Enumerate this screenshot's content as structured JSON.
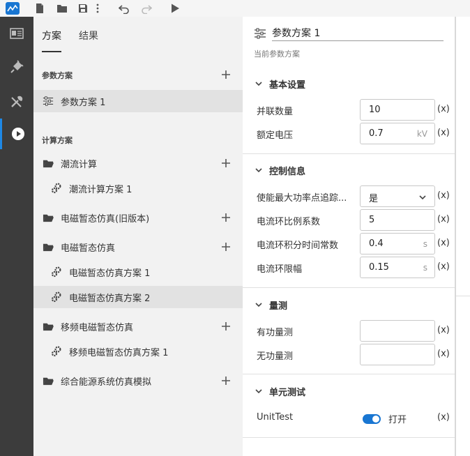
{
  "toolbar": {
    "icons": [
      "app-logo",
      "new-file-icon",
      "open-folder-icon",
      "save-icon",
      "more-icon",
      "undo-icon",
      "redo-icon",
      "run-icon"
    ]
  },
  "rail": {
    "items": [
      "panel-icon",
      "plugin-icon",
      "tools-icon",
      "play-icon"
    ],
    "accent": "#1e88e5"
  },
  "tree": {
    "tabs": [
      {
        "label": "方案"
      },
      {
        "label": "结果"
      }
    ],
    "param_section": {
      "title": "参数方案"
    },
    "param_items": [
      {
        "label": "参数方案 1"
      }
    ],
    "calc_section": {
      "title": "计算方案"
    },
    "calc_groups": [
      {
        "label": "潮流计算",
        "children": [
          {
            "label": "潮流计算方案 1"
          }
        ]
      },
      {
        "label": "电磁暂态仿真(旧版本)",
        "children": []
      },
      {
        "label": "电磁暂态仿真",
        "children": [
          {
            "label": "电磁暂态仿真方案 1"
          },
          {
            "label": "电磁暂态仿真方案 2"
          }
        ]
      },
      {
        "label": "移频电磁暂态仿真",
        "children": [
          {
            "label": "移频电磁暂态仿真方案 1"
          }
        ]
      },
      {
        "label": "综合能源系统仿真模拟",
        "children": []
      }
    ]
  },
  "params": {
    "title": "参数方案 1",
    "subtitle": "当前参数方案",
    "expr_tag": "(x)",
    "groups": {
      "basic": {
        "title": "基本设置",
        "fields": [
          {
            "label": "并联数量",
            "value": "10",
            "unit": ""
          },
          {
            "label": "额定电压",
            "value": "0.7",
            "unit": "kV"
          }
        ]
      },
      "control": {
        "title": "控制信息",
        "fields": [
          {
            "label": "使能最大功率点追踪...",
            "value": "是",
            "unit": ""
          },
          {
            "label": "电流环比例系数",
            "value": "5",
            "unit": ""
          },
          {
            "label": "电流环积分时间常数",
            "value": "0.4",
            "unit": "s"
          },
          {
            "label": "电流环限幅",
            "value": "0.15",
            "unit": "s"
          }
        ]
      },
      "measure": {
        "title": "量测",
        "fields": [
          {
            "label": "有功量测",
            "value": "",
            "unit": ""
          },
          {
            "label": "无功量测",
            "value": "",
            "unit": ""
          }
        ]
      },
      "unit": {
        "title": "单元测试",
        "fields": [
          {
            "label": "UnitTest",
            "toggle_label": "打开",
            "on": true
          }
        ]
      }
    }
  }
}
